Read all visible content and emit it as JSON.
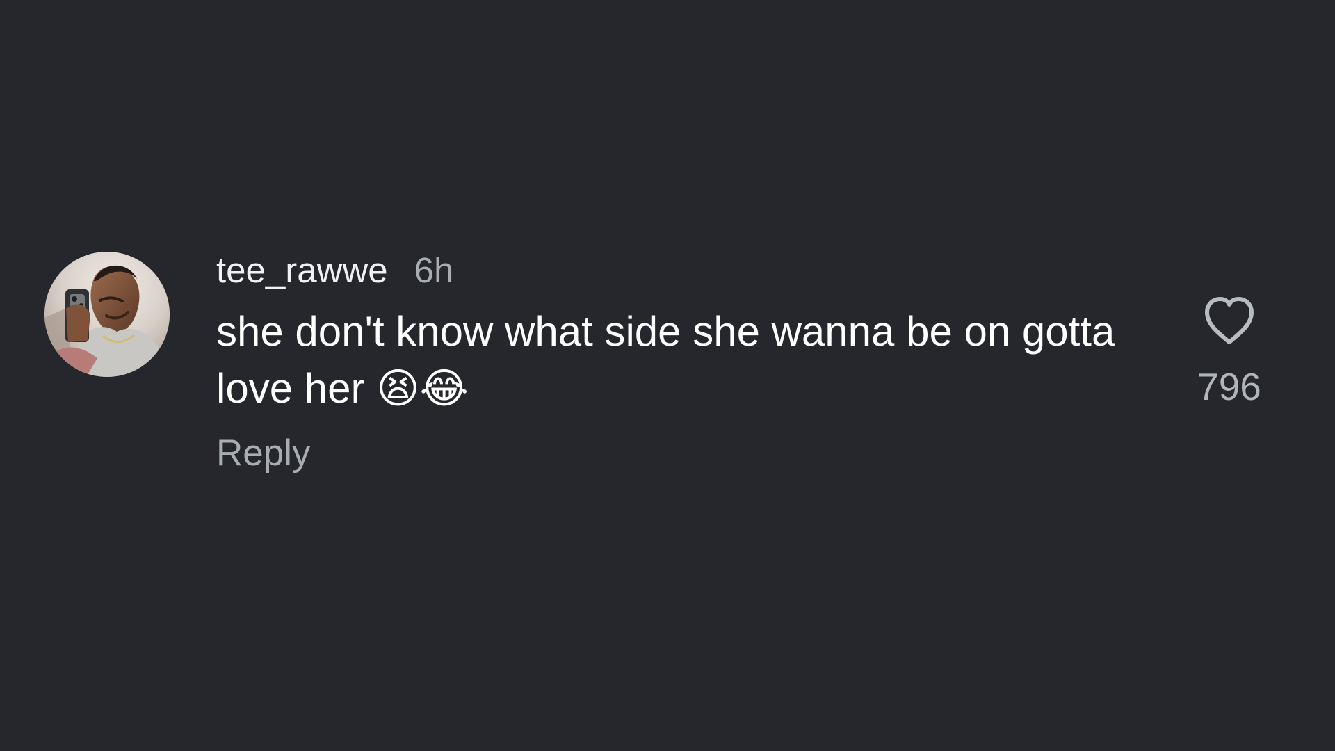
{
  "comment": {
    "username": "tee_rawwe",
    "timestamp": "6h",
    "text": "she don't know what side she wanna be on gotta love her 😫😂",
    "reply_label": "Reply",
    "like_count": "796"
  },
  "icons": {
    "avatar": "profile-photo",
    "like": "heart-outline-icon"
  },
  "colors": {
    "background": "#25272c",
    "username": "#f0f1f3",
    "muted": "#a8acb3",
    "comment_text": "#ffffff"
  }
}
